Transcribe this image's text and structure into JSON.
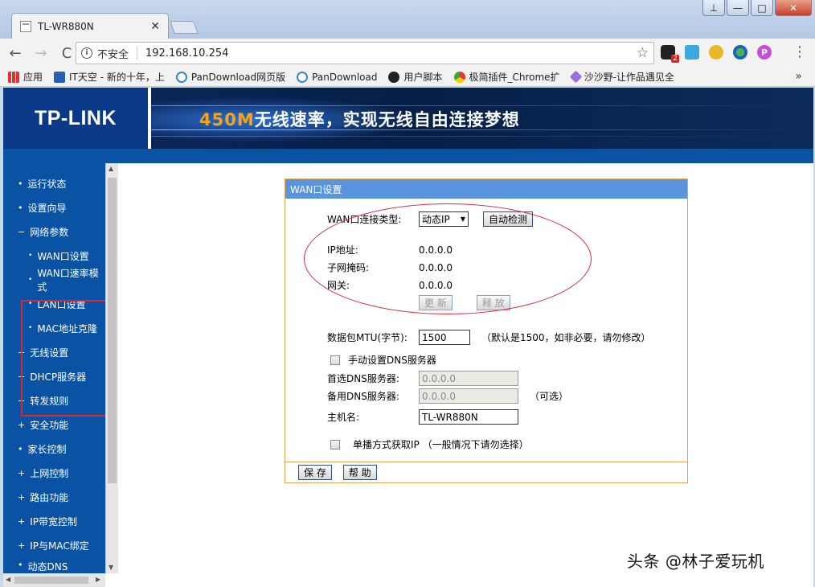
{
  "browser": {
    "tab_title": "TL-WR880N",
    "tab_close": "✕",
    "back": "←",
    "forward": "→",
    "reload": "C",
    "security_label": "不安全",
    "url": "192.168.10.254",
    "star": "☆",
    "ext_badge": "2",
    "ext_p": "P",
    "menu": "⋮",
    "window_min": "—",
    "window_max": "□",
    "window_close": "✕",
    "restore": "⊥",
    "bookmarks": [
      {
        "label": "应用",
        "icon": "apps-icon"
      },
      {
        "label": "IT天空 - 新的十年，上",
        "icon": "it-icon"
      },
      {
        "label": "PanDownload网页版",
        "icon": "cloud-icon"
      },
      {
        "label": "PanDownload",
        "icon": "cloud-icon"
      },
      {
        "label": "用户脚本",
        "icon": "script-icon"
      },
      {
        "label": "极简插件_Chrome扩",
        "icon": "chrome-icon"
      },
      {
        "label": "沙沙野-让作品遇见全",
        "icon": "sasha-icon"
      }
    ],
    "bookmarks_more": "»"
  },
  "router": {
    "logo": "TP-LINK",
    "slogan_highlight": "450M",
    "slogan_rest": "无线速率，实现无线自由连接梦想",
    "menu": [
      {
        "label": "运行状态",
        "bullet": "•",
        "sub": false
      },
      {
        "label": "设置向导",
        "bullet": "•",
        "sub": false
      },
      {
        "label": "网络参数",
        "bullet": "−",
        "sub": false
      },
      {
        "label": "WAN口设置",
        "bullet": "•",
        "sub": true
      },
      {
        "label": "WAN口速率模式",
        "bullet": "•",
        "sub": true
      },
      {
        "label": "LAN口设置",
        "bullet": "•",
        "sub": true
      },
      {
        "label": "MAC地址克隆",
        "bullet": "•",
        "sub": true
      },
      {
        "label": "无线设置",
        "bullet": "+",
        "sub": false
      },
      {
        "label": "DHCP服务器",
        "bullet": "+",
        "sub": false
      },
      {
        "label": "转发规则",
        "bullet": "+",
        "sub": false
      },
      {
        "label": "安全功能",
        "bullet": "+",
        "sub": false
      },
      {
        "label": "家长控制",
        "bullet": "•",
        "sub": false
      },
      {
        "label": "上网控制",
        "bullet": "+",
        "sub": false
      },
      {
        "label": "路由功能",
        "bullet": "+",
        "sub": false
      },
      {
        "label": "IP带宽控制",
        "bullet": "+",
        "sub": false
      },
      {
        "label": "IP与MAC绑定",
        "bullet": "+",
        "sub": false
      },
      {
        "label": "动态DNS",
        "bullet": "•",
        "sub": false
      }
    ],
    "panel": {
      "title": "WAN口设置",
      "conn_type_label": "WAN口连接类型:",
      "conn_type_value": "动态IP",
      "auto_detect": "自动检测",
      "ip_label": "IP地址:",
      "ip_value": "0.0.0.0",
      "mask_label": "子网掩码:",
      "mask_value": "0.0.0.0",
      "gw_label": "网关:",
      "gw_value": "0.0.0.0",
      "renew": "更 新",
      "release": "释 放",
      "mtu_label": "数据包MTU(字节):",
      "mtu_value": "1500",
      "mtu_hint": "（默认是1500，如非必要，请勿修改）",
      "manual_dns_label": "手动设置DNS服务器",
      "dns1_label": "首选DNS服务器:",
      "dns1_value": "0.0.0.0",
      "dns2_label": "备用DNS服务器:",
      "dns2_value": "0.0.0.0",
      "dns2_hint": "（可选）",
      "hostname_label": "主机名:",
      "hostname_value": "TL-WR880N",
      "unicast_label": "单播方式获取IP （一般情况下请勿选择）",
      "save": "保 存",
      "help": "帮 助"
    }
  },
  "watermark": "头条 @林子爱玩机"
}
